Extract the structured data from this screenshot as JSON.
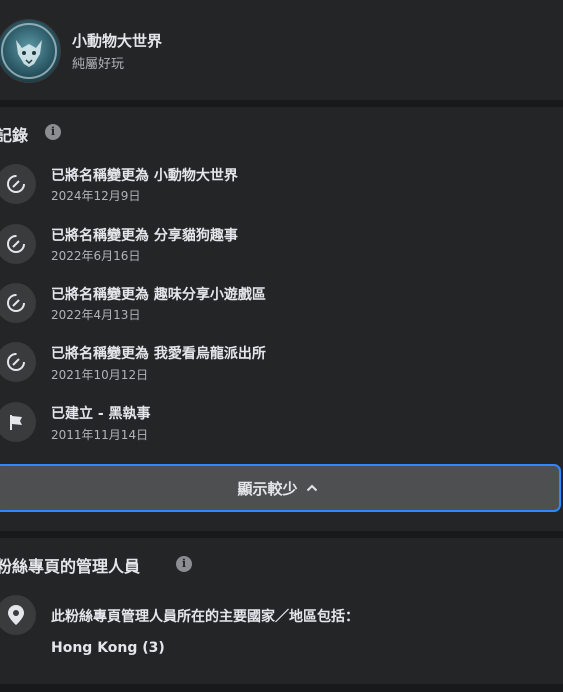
{
  "page": {
    "name": "小動物大世界",
    "subtitle": "純屬好玩"
  },
  "history": {
    "title": "記錄",
    "items": [
      {
        "title": "已將名稱變更為 小動物大世界",
        "date": "2024年12月9日",
        "icon": "rename-icon"
      },
      {
        "title": "已將名稱變更為 分享貓狗趣事",
        "date": "2022年6月16日",
        "icon": "rename-icon"
      },
      {
        "title": "已將名稱變更為 趣味分享小遊戲區",
        "date": "2022年4月13日",
        "icon": "rename-icon"
      },
      {
        "title": "已將名稱變更為 我愛看烏龍派出所",
        "date": "2021年10月12日",
        "icon": "rename-icon"
      },
      {
        "title": "已建立 - 黑執事",
        "date": "2011年11月14日",
        "icon": "flag-icon"
      }
    ],
    "toggle_label": "顯示較少"
  },
  "admins": {
    "title": "粉絲專頁的管理人員",
    "location_text": "此粉絲專頁管理人員所在的主要國家／地區包括：",
    "country": "Hong Kong (3)"
  },
  "colors": {
    "background": "#18191a",
    "card": "#242526",
    "accent": "#2d88ff",
    "button": "#4e4f50"
  }
}
